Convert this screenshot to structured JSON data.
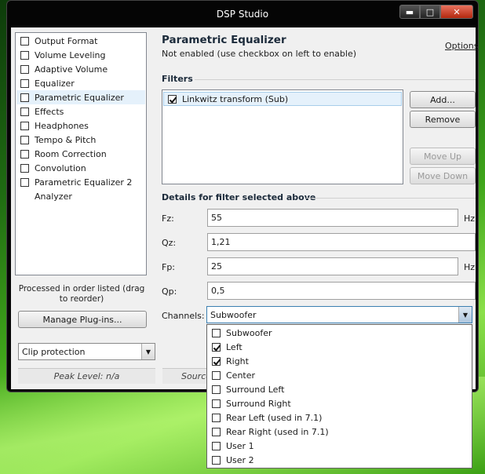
{
  "window": {
    "title": "DSP Studio",
    "minimize_label": "▬",
    "maximize_label": "□",
    "close_label": "✕"
  },
  "sidebar": {
    "items": [
      {
        "label": "Output Format",
        "checked": false,
        "has_checkbox": true,
        "selected": false
      },
      {
        "label": "Volume Leveling",
        "checked": false,
        "has_checkbox": true,
        "selected": false
      },
      {
        "label": "Adaptive Volume",
        "checked": false,
        "has_checkbox": true,
        "selected": false
      },
      {
        "label": "Equalizer",
        "checked": false,
        "has_checkbox": true,
        "selected": false
      },
      {
        "label": "Parametric Equalizer",
        "checked": false,
        "has_checkbox": true,
        "selected": true
      },
      {
        "label": "Effects",
        "checked": false,
        "has_checkbox": true,
        "selected": false
      },
      {
        "label": "Headphones",
        "checked": false,
        "has_checkbox": true,
        "selected": false
      },
      {
        "label": "Tempo & Pitch",
        "checked": false,
        "has_checkbox": true,
        "selected": false
      },
      {
        "label": "Room Correction",
        "checked": false,
        "has_checkbox": true,
        "selected": false
      },
      {
        "label": "Convolution",
        "checked": false,
        "has_checkbox": true,
        "selected": false
      },
      {
        "label": "Parametric Equalizer 2",
        "checked": false,
        "has_checkbox": true,
        "selected": false
      },
      {
        "label": "Analyzer",
        "checked": false,
        "has_checkbox": false,
        "selected": false
      }
    ],
    "processed_note": "Processed in order listed (drag to reorder)",
    "manage_plugins_label": "Manage Plug-ins...",
    "clip_protection_value": "Clip protection",
    "peak_level": "Peak Level: n/a",
    "source_label": "Source"
  },
  "main": {
    "title": "Parametric Equalizer",
    "subtitle": "Not enabled (use checkbox on left to enable)",
    "options_label": "Options",
    "filters_heading": "Filters",
    "filters": [
      {
        "label": "Linkwitz transform (Sub)",
        "checked": true
      }
    ],
    "buttons": {
      "add": "Add...",
      "remove": "Remove",
      "move_up": "Move Up",
      "move_down": "Move Down"
    },
    "details_heading": "Details for filter selected above",
    "fields": {
      "fz_label": "Fz:",
      "fz_value": "55",
      "fz_unit": "Hz",
      "qz_label": "Qz:",
      "qz_value": "1,21",
      "fp_label": "Fp:",
      "fp_value": "25",
      "fp_unit": "Hz",
      "qp_label": "Qp:",
      "qp_value": "0,5",
      "channels_label": "Channels:",
      "channels_value": "Subwoofer"
    },
    "channel_options": [
      {
        "label": "Subwoofer",
        "checked": false
      },
      {
        "label": "Left",
        "checked": true
      },
      {
        "label": "Right",
        "checked": true
      },
      {
        "label": "Center",
        "checked": false
      },
      {
        "label": "Surround Left",
        "checked": false
      },
      {
        "label": "Surround Right",
        "checked": false
      },
      {
        "label": "Rear Left (used in 7.1)",
        "checked": false
      },
      {
        "label": "Rear Right (used in 7.1)",
        "checked": false
      },
      {
        "label": "User 1",
        "checked": false
      },
      {
        "label": "User 2",
        "checked": false
      }
    ]
  }
}
